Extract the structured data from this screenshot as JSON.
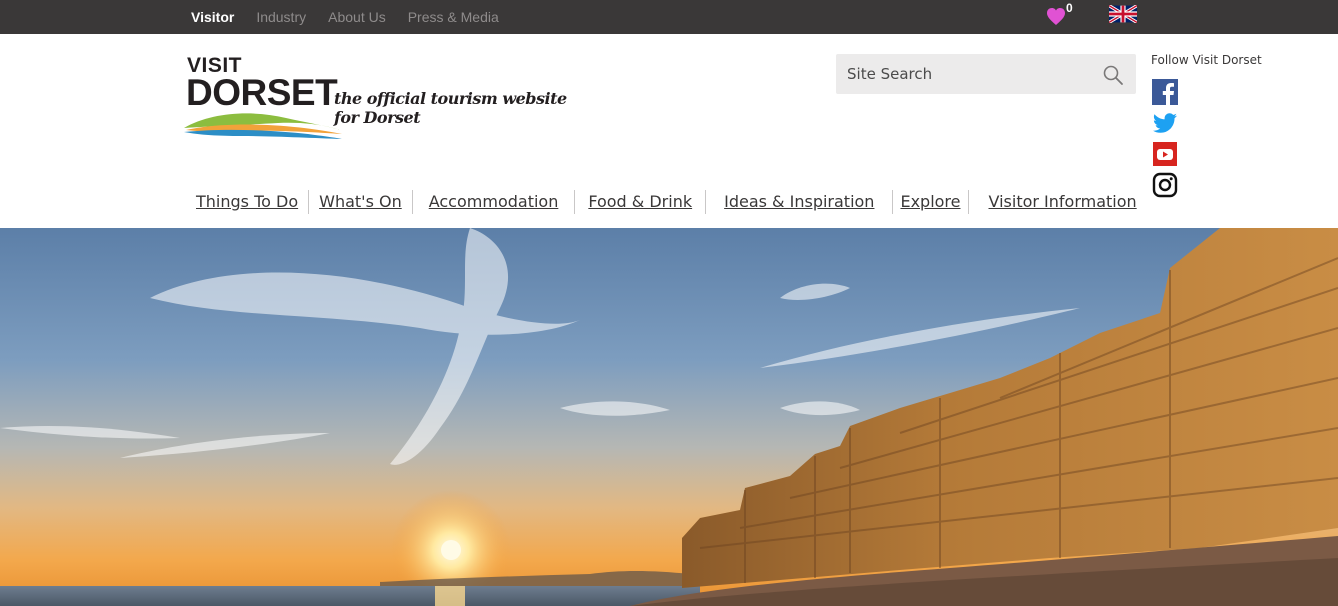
{
  "topbar": {
    "nav": [
      "Visitor",
      "Industry",
      "About Us",
      "Press & Media"
    ],
    "active_index": 0,
    "favourites_count": "0",
    "favourites_icon": "heart-icon",
    "language_icon": "uk-flag-icon"
  },
  "logo": {
    "visit": "VISIT",
    "dorset": "DORSET",
    "tagline": "the official tourism website for Dorset"
  },
  "search": {
    "placeholder": "Site Search",
    "icon": "search-icon"
  },
  "social": {
    "heading": "Follow Visit Dorset",
    "icons": [
      "facebook-icon",
      "twitter-icon",
      "youtube-icon",
      "instagram-icon"
    ]
  },
  "main_nav": [
    "Things To Do",
    "What's On",
    "Accommodation",
    "Food & Drink",
    "Ideas & Inspiration",
    "Explore",
    "Visitor Information"
  ],
  "colors": {
    "topbar_bg": "#3a3838",
    "heart": "#e052d3",
    "facebook": "#3b5998",
    "twitter": "#1da1f2",
    "youtube": "#d7251f",
    "wave_green": "#8cbd3f",
    "wave_orange": "#f2a23a",
    "wave_blue": "#2c8ec6"
  }
}
